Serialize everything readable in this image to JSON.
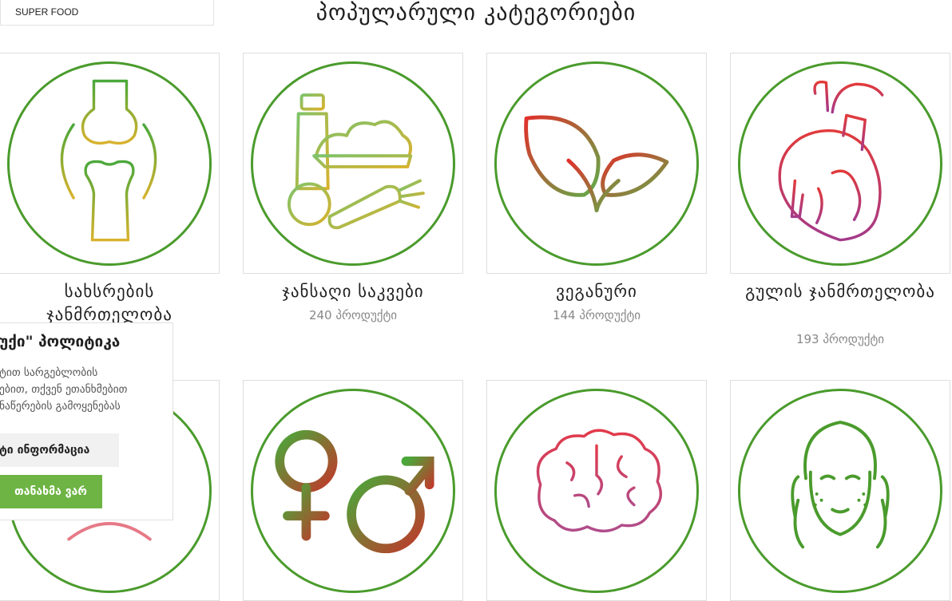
{
  "menu": {
    "label": "SUPER FOOD"
  },
  "section": {
    "title": "პოპულარული კატეგორიები"
  },
  "categories": [
    {
      "name": "სახსრების ჯანმრთელობა",
      "count": "",
      "icon": "joint-icon"
    },
    {
      "name": "ჯანსაღი საკვები",
      "count": "240 პროდუქტი",
      "icon": "healthy-food-icon"
    },
    {
      "name": "ვეგანური",
      "count": "144 პროდუქტი",
      "icon": "vegan-leaves-icon"
    },
    {
      "name": "გულის ჯანმრთელობა",
      "count": "193 პროდუქტი",
      "icon": "heart-icon"
    },
    {
      "name": "",
      "count": "",
      "icon": "partial-icon"
    },
    {
      "name": "",
      "count": "",
      "icon": "gender-icon"
    },
    {
      "name": "",
      "count": "",
      "icon": "brain-icon"
    },
    {
      "name": "",
      "count": "",
      "icon": "face-icon"
    }
  ],
  "cookie": {
    "title": "უქი\" პოლიტიკა",
    "line1": "ტით სარგებლობის",
    "line2": "ებით, თქვენ ეთანხმებით",
    "line3": "ნაწერების გამოყენებას",
    "more_label": "ტი ინფორმაცია",
    "agree_label": "თანახმა ვარ"
  },
  "colors": {
    "accent_green": "#4a9b2c",
    "button_green": "#6eb444"
  }
}
